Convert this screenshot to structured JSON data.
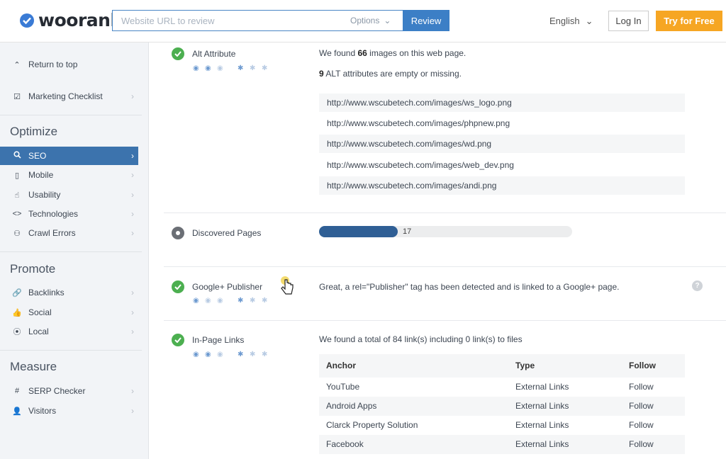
{
  "brand": {
    "name": "woorank",
    "color": "#3a7bd5"
  },
  "header": {
    "search_placeholder": "Website URL to review",
    "options_label": "Options",
    "review_label": "Review",
    "language": "English",
    "login_label": "Log In",
    "try_label": "Try for Free"
  },
  "sidebar": {
    "return_top": "Return to top",
    "marketing_checklist": "Marketing Checklist",
    "sections": [
      {
        "heading": "Optimize",
        "items": [
          "SEO",
          "Mobile",
          "Usability",
          "Technologies",
          "Crawl Errors"
        ]
      },
      {
        "heading": "Promote",
        "items": [
          "Backlinks",
          "Social",
          "Local"
        ]
      },
      {
        "heading": "Measure",
        "items": [
          "SERP Checker",
          "Visitors"
        ]
      }
    ],
    "active_item": "SEO",
    "active_color": "#3c73ad"
  },
  "alt_attribute": {
    "title": "Alt Attribute",
    "found_prefix": "We found ",
    "found_count": "66",
    "found_suffix": " images on this web page.",
    "missing_count": "9",
    "missing_suffix": " ALT attributes are empty or missing.",
    "urls": [
      "http://www.wscubetech.com/images/ws_logo.png",
      "http://www.wscubetech.com/images/phpnew.png",
      "http://www.wscubetech.com/images/wd.png",
      "http://www.wscubetech.com/images/web_dev.png",
      "http://www.wscubetech.com/images/andi.png"
    ]
  },
  "discovered_pages": {
    "title": "Discovered Pages",
    "value": "17",
    "fill_fraction": 0.31
  },
  "google_publisher": {
    "title": "Google+ Publisher",
    "message": "Great, a rel=\"Publisher\" tag has been detected and is linked to a Google+ page.",
    "help": "?"
  },
  "in_page_links": {
    "title": "In-Page Links",
    "summary": "We found a total of 84 link(s) including 0 link(s) to files",
    "columns": [
      "Anchor",
      "Type",
      "Follow"
    ],
    "rows": [
      [
        "YouTube",
        "External Links",
        "Follow"
      ],
      [
        "Android Apps",
        "External Links",
        "Follow"
      ],
      [
        "Clarck Property Solution",
        "External Links",
        "Follow"
      ],
      [
        "Facebook",
        "External Links",
        "Follow"
      ]
    ]
  },
  "colors": {
    "check": "#4caf50",
    "accent_blue": "#3c7fc6",
    "orange": "#f6a623",
    "progress": "#2f5f95"
  }
}
